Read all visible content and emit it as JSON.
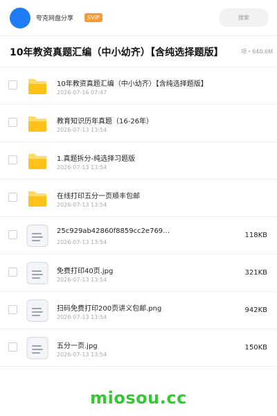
{
  "header": {
    "name": "夸克网盘分享",
    "badge": "SVIP",
    "search_label": "搜索"
  },
  "folder": {
    "title": "10年教资真题汇编（中小幼齐）【含纯选择题版】",
    "meta": "项・640.6M"
  },
  "files": [
    {
      "type": "folder",
      "name": "10年教资真题汇编（中小幼齐）【含纯选择题版】",
      "date": "2026-07-16 07:47",
      "size": ""
    },
    {
      "type": "folder",
      "name": "教育知识历年真题（16-26年）",
      "date": "2026-07-13 13:54",
      "size": ""
    },
    {
      "type": "folder",
      "name": "1.真题拆分-纯选择习题版",
      "date": "2026-07-13 13:54",
      "size": ""
    },
    {
      "type": "folder",
      "name": "在线打印五分一页顺丰包邮",
      "date": "2026-07-13 13:54",
      "size": ""
    },
    {
      "type": "file",
      "name": "25c929ab42860f8859cc2e769…",
      "date": "2026-07-13 13:54",
      "size": "118KB"
    },
    {
      "type": "file",
      "name": "免费打印40页.jpg",
      "date": "2026-07-13 13:54",
      "size": "321KB"
    },
    {
      "type": "file",
      "name": "扫码免费打印200页讲义包邮.png",
      "date": "2026-07-13 13:54",
      "size": "942KB"
    },
    {
      "type": "file",
      "name": "五分一页.jpg",
      "date": "2026-07-13 13:54",
      "size": "150KB"
    }
  ],
  "watermark": "miosou.cc",
  "colors": {
    "avatar": "#1e7cf7",
    "badge": "#f79a33",
    "folder_icon": "#ffc21a",
    "watermark": "#32c932"
  },
  "icons": {
    "folder": "folder-icon",
    "file": "document-icon"
  }
}
